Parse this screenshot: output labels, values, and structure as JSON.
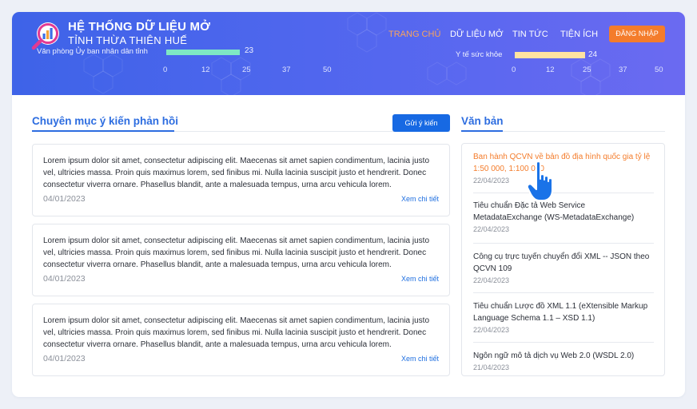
{
  "header": {
    "title": "HỆ THỐNG DỮ LIỆU MỞ",
    "subtitle": "TỈNH THỪA THIÊN HUẾ",
    "nav": [
      "TRANG CHỦ",
      "DỮ LIỆU MỞ",
      "TIN TỨC",
      "TIỆN ÍCH"
    ],
    "login_label": "ĐĂNG NHẬP",
    "colors": {
      "accent": "#f47c2b",
      "brand": "#4a63ea"
    }
  },
  "chart_data": [
    {
      "type": "bar",
      "categories": [
        "Văn phòng Ủy ban nhân dân tỉnh"
      ],
      "values": [
        23
      ],
      "xticks": [
        "0",
        "12",
        "25",
        "37",
        "50"
      ],
      "xlim": [
        0,
        50
      ]
    },
    {
      "type": "bar",
      "categories": [
        "Y tế sức khỏe"
      ],
      "values": [
        24
      ],
      "xticks": [
        "0",
        "12",
        "25",
        "37",
        "50"
      ],
      "xlim": [
        0,
        50
      ]
    }
  ],
  "feedback": {
    "title": "Chuyên mục ý kiến phản hồi",
    "send_label": "Gửi ý kiến",
    "more_label": "Xem chi tiết",
    "items": [
      {
        "text": "Lorem ipsum dolor sit amet, consectetur adipiscing elit. Maecenas sit amet sapien condimentum, lacinia justo vel, ultricies massa. Proin quis maximus lorem, sed finibus mi. Nulla lacinia suscipit justo et hendrerit. Donec consectetur viverra ornare. Phasellus blandit, ante a malesuada tempus, urna arcu vehicula lorem.",
        "date": "04/01/2023"
      },
      {
        "text": "Lorem ipsum dolor sit amet, consectetur adipiscing elit. Maecenas sit amet sapien condimentum, lacinia justo vel, ultricies massa. Proin quis maximus lorem, sed finibus mi. Nulla lacinia suscipit justo et hendrerit. Donec consectetur viverra ornare. Phasellus blandit, ante a malesuada tempus, urna arcu vehicula lorem.",
        "date": "04/01/2023"
      },
      {
        "text": "Lorem ipsum dolor sit amet, consectetur adipiscing elit. Maecenas sit amet sapien condimentum, lacinia justo vel, ultricies massa. Proin quis maximus lorem, sed finibus mi. Nulla lacinia suscipit justo et hendrerit. Donec consectetur viverra ornare. Phasellus blandit, ante a malesuada tempus, urna arcu vehicula lorem.",
        "date": "04/01/2023"
      }
    ]
  },
  "documents": {
    "title": "Văn bản",
    "items": [
      {
        "title": "Ban hành QCVN về bản đồ địa hình quốc gia tỷ lệ 1:50 000, 1:100 000",
        "date": "22/04/2023"
      },
      {
        "title": "Tiêu chuẩn Đặc tả Web Service MetadataExchange (WS-MetadataExchange)",
        "date": "22/04/2023"
      },
      {
        "title": "Công cụ trực tuyến chuyển đổi XML -- JSON theo QCVN 109",
        "date": "22/04/2023"
      },
      {
        "title": "Tiêu chuẩn Lược đồ XML 1.1 (eXtensible Markup Language Schema 1.1 – XSD 1.1)",
        "date": "22/04/2023"
      },
      {
        "title": "Ngôn ngữ mô tả dịch vụ Web 2.0 (WSDL 2.0)",
        "date": "21/04/2023"
      }
    ]
  },
  "icons": [
    "search-chart-logo-icon",
    "pointer-hand-icon"
  ]
}
